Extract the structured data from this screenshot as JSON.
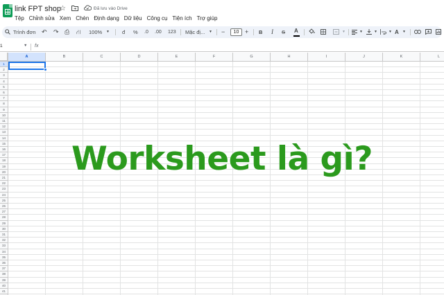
{
  "title_bar": {
    "document_title": "link FPT shop",
    "star_icon": "star-icon",
    "move_icon": "folder-move-icon",
    "cloud_icon": "cloud-saved-icon",
    "save_status": "Đã lưu vào Drive"
  },
  "menu": [
    "Tệp",
    "Chỉnh sửa",
    "Xem",
    "Chèn",
    "Định dạng",
    "Dữ liệu",
    "Công cụ",
    "Tiện ích",
    "Trợ giúp"
  ],
  "toolbar": {
    "search_menus": "Trình đơn",
    "undo": "↶",
    "redo": "↷",
    "print": "⎙",
    "paint_format": "⛙",
    "zoom": "100%",
    "currency": "đ",
    "percent": "%",
    "decrease_decimal": ".0",
    "increase_decimal": ".00",
    "number_format": "123",
    "font_name": "Mặc đị...",
    "font_size_decrease": "−",
    "font_size": "10",
    "font_size_increase": "+",
    "bold": "B",
    "italic": "I",
    "strikethrough": "S",
    "text_color": "A"
  },
  "formula_bar": {
    "name_box": "1",
    "fx_label": "fx"
  },
  "grid": {
    "columns": [
      "A",
      "B",
      "C",
      "D",
      "E",
      "F",
      "G",
      "H",
      "I",
      "J",
      "K",
      "L"
    ],
    "rows": [
      "1",
      "2",
      "3",
      "4",
      "5",
      "6",
      "7",
      "8",
      "9",
      "10",
      "11",
      "12",
      "13",
      "14",
      "15",
      "16",
      "17",
      "18",
      "19",
      "20",
      "21",
      "22",
      "23",
      "24",
      "25",
      "26",
      "27",
      "28",
      "29",
      "30",
      "31",
      "32",
      "33",
      "34",
      "35",
      "36",
      "37",
      "38",
      "39",
      "40",
      "41",
      "42"
    ],
    "selected_cell": "A1"
  },
  "overlay": {
    "heading": "Worksheet là gì?",
    "color": "#2b9a1d"
  },
  "colors": {
    "accent": "#1a73e8",
    "sheets_green": "#0f9d58",
    "toolbar_bg": "#eef2f9"
  }
}
